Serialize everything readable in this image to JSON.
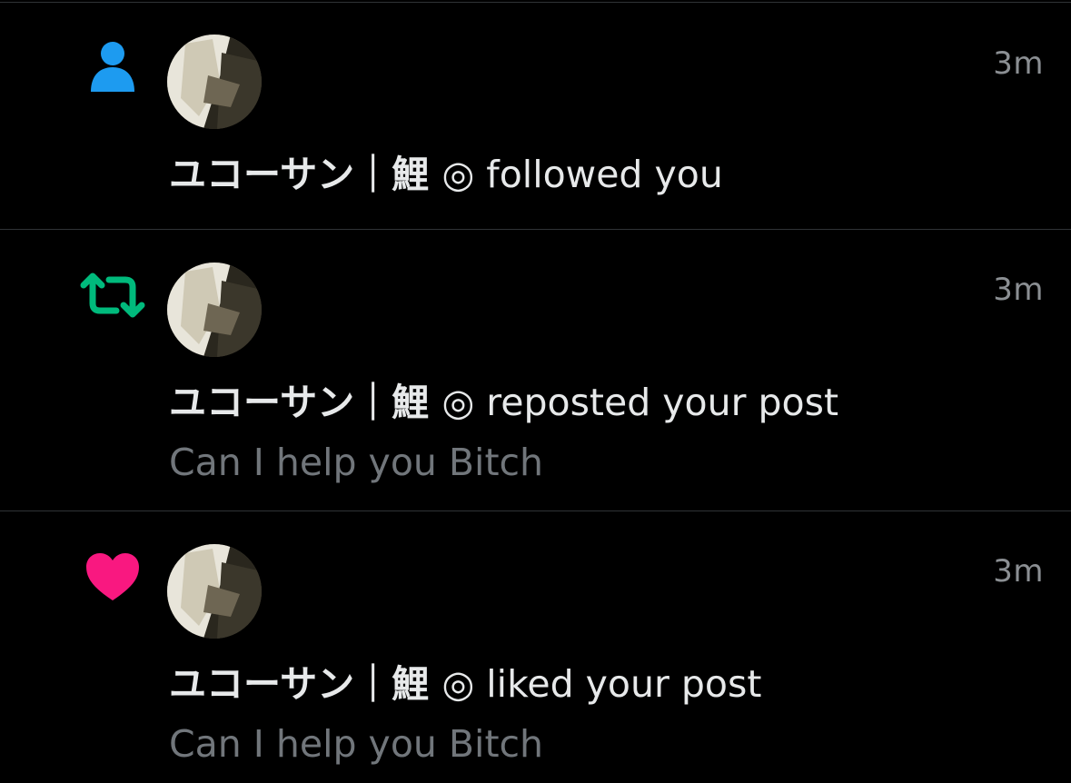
{
  "colors": {
    "follow_icon": "#1d9bf0",
    "repost_icon": "#00ba7c",
    "like_icon": "#f91880",
    "background": "#000000",
    "primary_text": "#e7e9ea",
    "secondary_text": "#71767b",
    "timestamp_text": "#8b8f93",
    "divider": "#2f3336"
  },
  "notifications": [
    {
      "type_icon": "person-icon",
      "user_name": "ユコーサン｜鯉 ◎",
      "action": "followed you",
      "timestamp": "3m",
      "snippet": ""
    },
    {
      "type_icon": "repost-icon",
      "user_name": "ユコーサン｜鯉 ◎",
      "action": "reposted your post",
      "timestamp": "3m",
      "snippet": "Can I help you Bitch"
    },
    {
      "type_icon": "heart-icon",
      "user_name": "ユコーサン｜鯉 ◎",
      "action": "liked your post",
      "timestamp": "3m",
      "snippet": "Can I help you Bitch"
    }
  ]
}
